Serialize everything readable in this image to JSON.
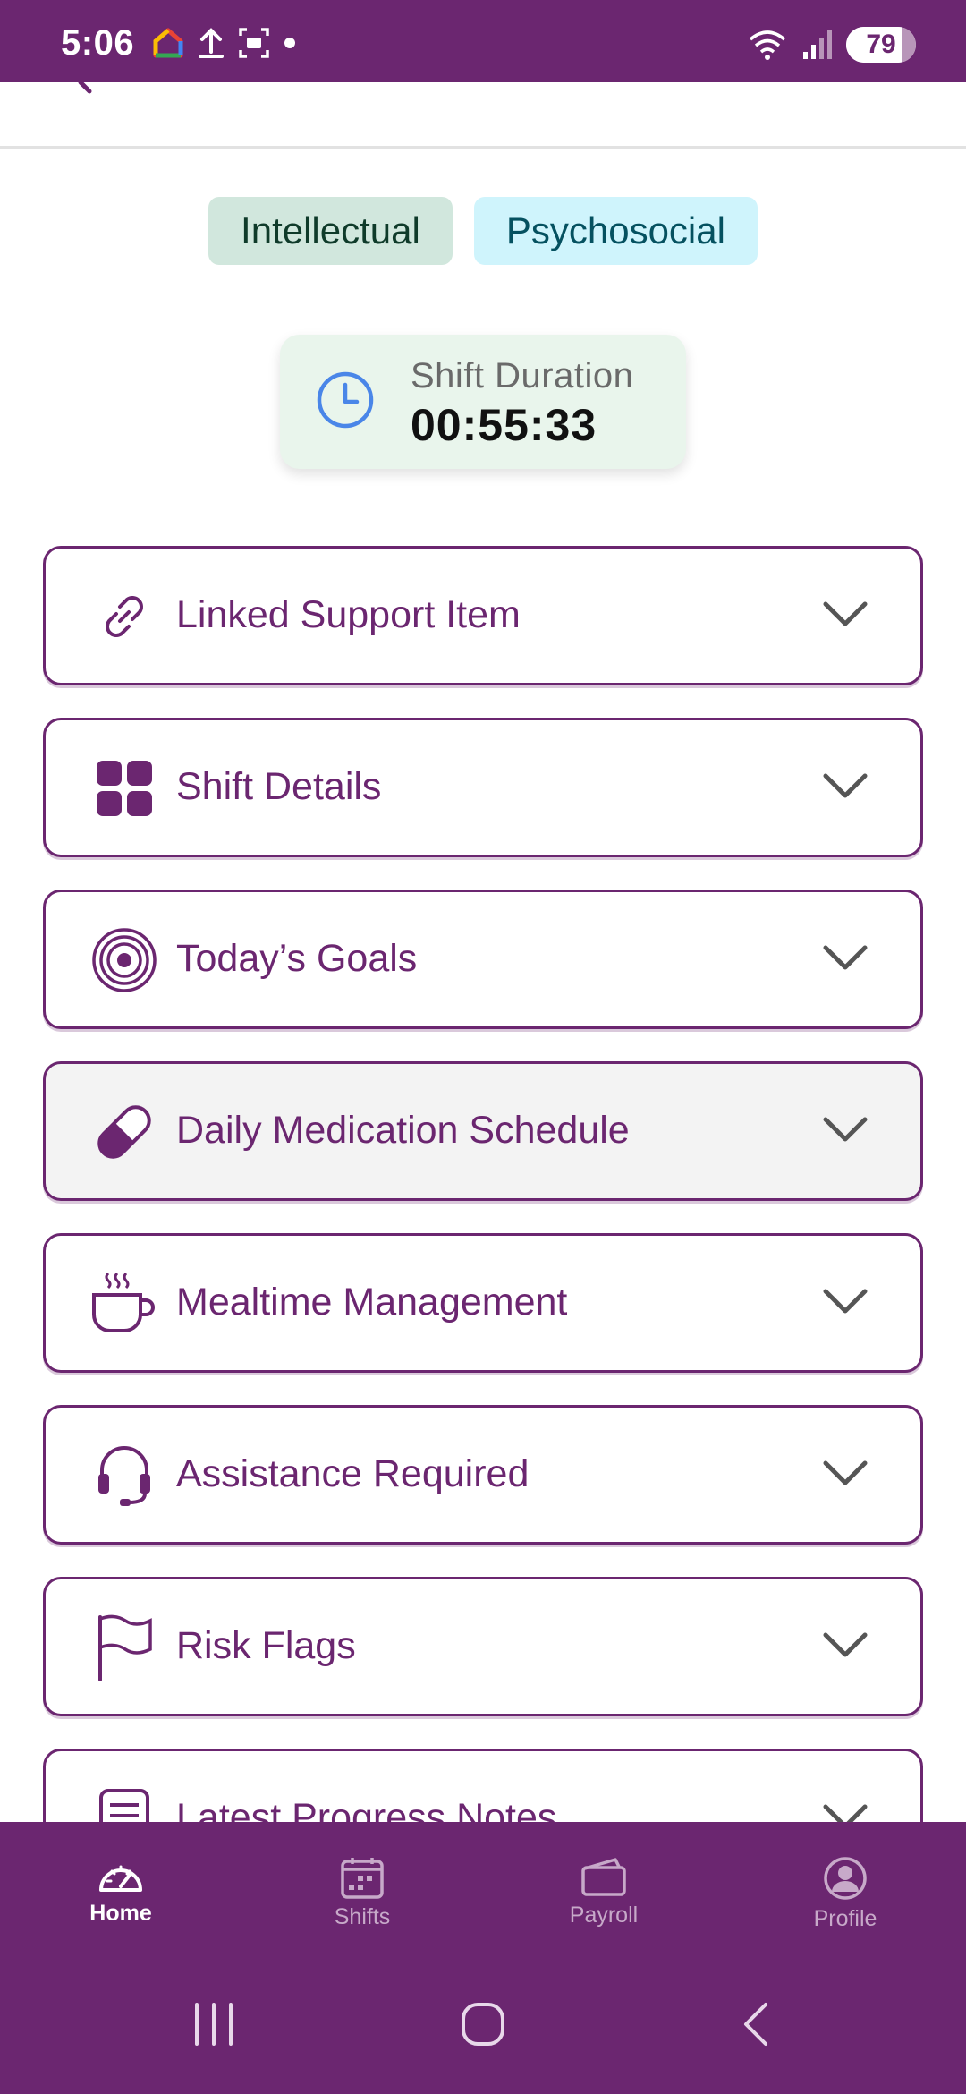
{
  "status_bar": {
    "time": "5:06",
    "battery": "79",
    "left_icons": [
      "home-color-icon",
      "upload-icon",
      "screenshot-icon",
      "dot-icon"
    ],
    "right_icons": [
      "wifi-icon",
      "signal-icon",
      "battery-icon"
    ]
  },
  "tags": [
    {
      "label": "Intellectual"
    },
    {
      "label": "Psychosocial"
    }
  ],
  "shift_duration": {
    "label": "Shift Duration",
    "value": "00:55:33"
  },
  "sections": [
    {
      "label": "Linked Support Item",
      "icon": "link-icon"
    },
    {
      "label": "Shift Details",
      "icon": "grid-icon"
    },
    {
      "label": "Today’s Goals",
      "icon": "target-icon"
    },
    {
      "label": "Daily Medication Schedule",
      "icon": "pill-icon"
    },
    {
      "label": "Mealtime Management",
      "icon": "hot-cup-icon"
    },
    {
      "label": "Assistance Required",
      "icon": "headset-icon"
    },
    {
      "label": "Risk Flags",
      "icon": "flag-icon"
    },
    {
      "label": "Latest Progress Notes",
      "icon": "notes-icon"
    }
  ],
  "bottom_nav": [
    {
      "label": "Home",
      "icon": "speedometer-icon",
      "active": true
    },
    {
      "label": "Shifts",
      "icon": "calendar-icon",
      "active": false
    },
    {
      "label": "Payroll",
      "icon": "wallet-icon",
      "active": false
    },
    {
      "label": "Profile",
      "icon": "user-circle-icon",
      "active": false
    }
  ],
  "colors": {
    "brand": "#6b2670",
    "tag_intellectual_bg": "#d1e7dd",
    "tag_psychosocial_bg": "#cff4fc",
    "duration_card_bg": "#e9f5ec",
    "clock_blue": "#4a86e8"
  }
}
